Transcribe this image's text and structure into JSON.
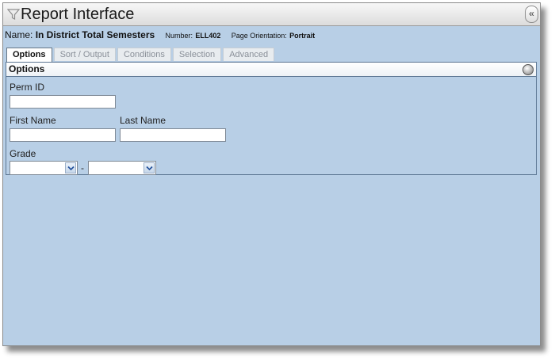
{
  "window": {
    "title": "Report Interface",
    "collapse_label": "«"
  },
  "report": {
    "name_label": "Name:",
    "name_value": "In District Total Semesters",
    "number_label": "Number:",
    "number_value": "ELL402",
    "orientation_label": "Page Orientation:",
    "orientation_value": "Portrait"
  },
  "tabs": [
    {
      "label": "Options",
      "active": true
    },
    {
      "label": "Sort / Output",
      "active": false
    },
    {
      "label": "Conditions",
      "active": false
    },
    {
      "label": "Selection",
      "active": false
    },
    {
      "label": "Advanced",
      "active": false
    }
  ],
  "options_panel": {
    "title": "Options",
    "perm_id": {
      "label": "Perm ID",
      "value": ""
    },
    "first_name": {
      "label": "First Name",
      "value": ""
    },
    "last_name": {
      "label": "Last Name",
      "value": ""
    },
    "grade": {
      "label": "Grade",
      "from_value": "",
      "separator": "-",
      "to_value": ""
    }
  }
}
